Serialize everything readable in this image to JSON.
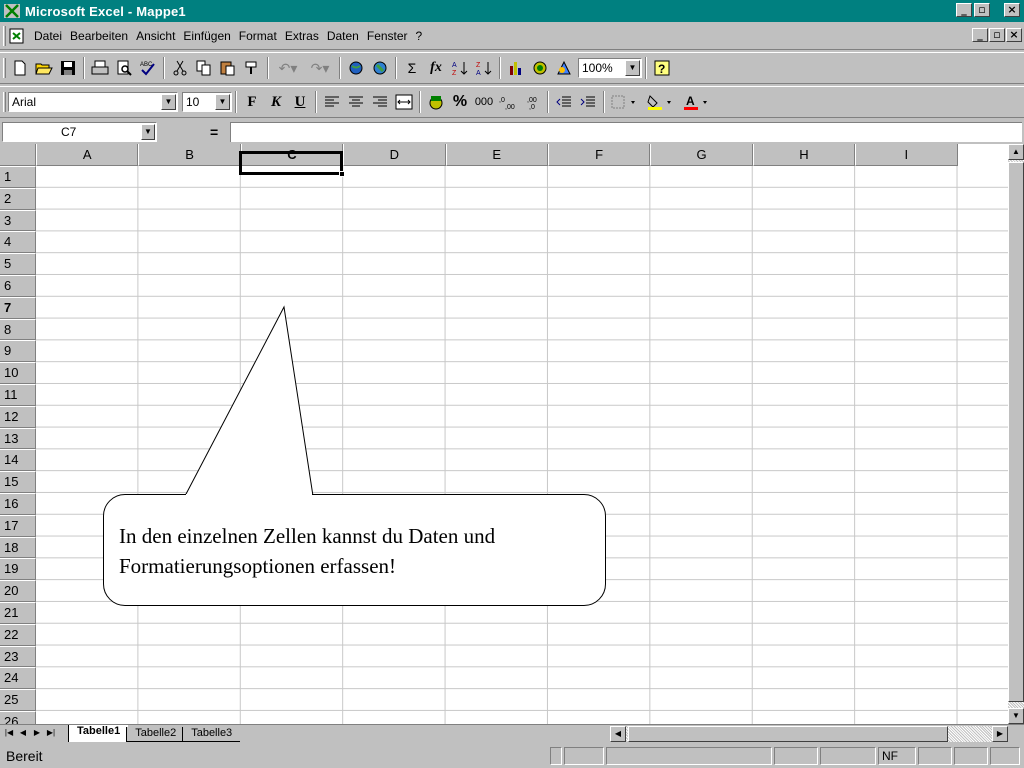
{
  "window": {
    "title": "Microsoft Excel - Mappe1",
    "controls": [
      "_",
      "̅",
      "×"
    ]
  },
  "menu": {
    "items": [
      "Datei",
      "Bearbeiten",
      "Ansicht",
      "Einfügen",
      "Format",
      "Extras",
      "Daten",
      "Fenster",
      "?"
    ]
  },
  "toolbar": {
    "zoom": "100%",
    "font_name": "Arial",
    "font_size": "10",
    "bold_label": "F",
    "italic_label": "K",
    "underline_label": "U",
    "sum_label": "Σ",
    "fx_label": "fx",
    "percent_label": "%",
    "thousands_label": "000"
  },
  "formula_bar": {
    "name_box": "C7",
    "equals": "=",
    "value": ""
  },
  "grid": {
    "columns": [
      "A",
      "B",
      "C",
      "D",
      "E",
      "F",
      "G",
      "H",
      "I"
    ],
    "rows": [
      "1",
      "2",
      "3",
      "4",
      "5",
      "6",
      "7",
      "8",
      "9",
      "10",
      "11",
      "12",
      "13",
      "14",
      "15",
      "16",
      "17",
      "18",
      "19",
      "20",
      "21",
      "22",
      "23",
      "24",
      "25",
      "26"
    ],
    "active_column": "C",
    "active_row": "7"
  },
  "sheets": {
    "tabs": [
      "Tabelle1",
      "Tabelle2",
      "Tabelle3"
    ],
    "active": "Tabelle1"
  },
  "status": {
    "text": "Bereit",
    "indicator": "NF"
  },
  "callout": {
    "line1": "In den einzelnen Zellen kannst du Daten und",
    "line2": "Formatierungsoptionen erfassen!"
  }
}
